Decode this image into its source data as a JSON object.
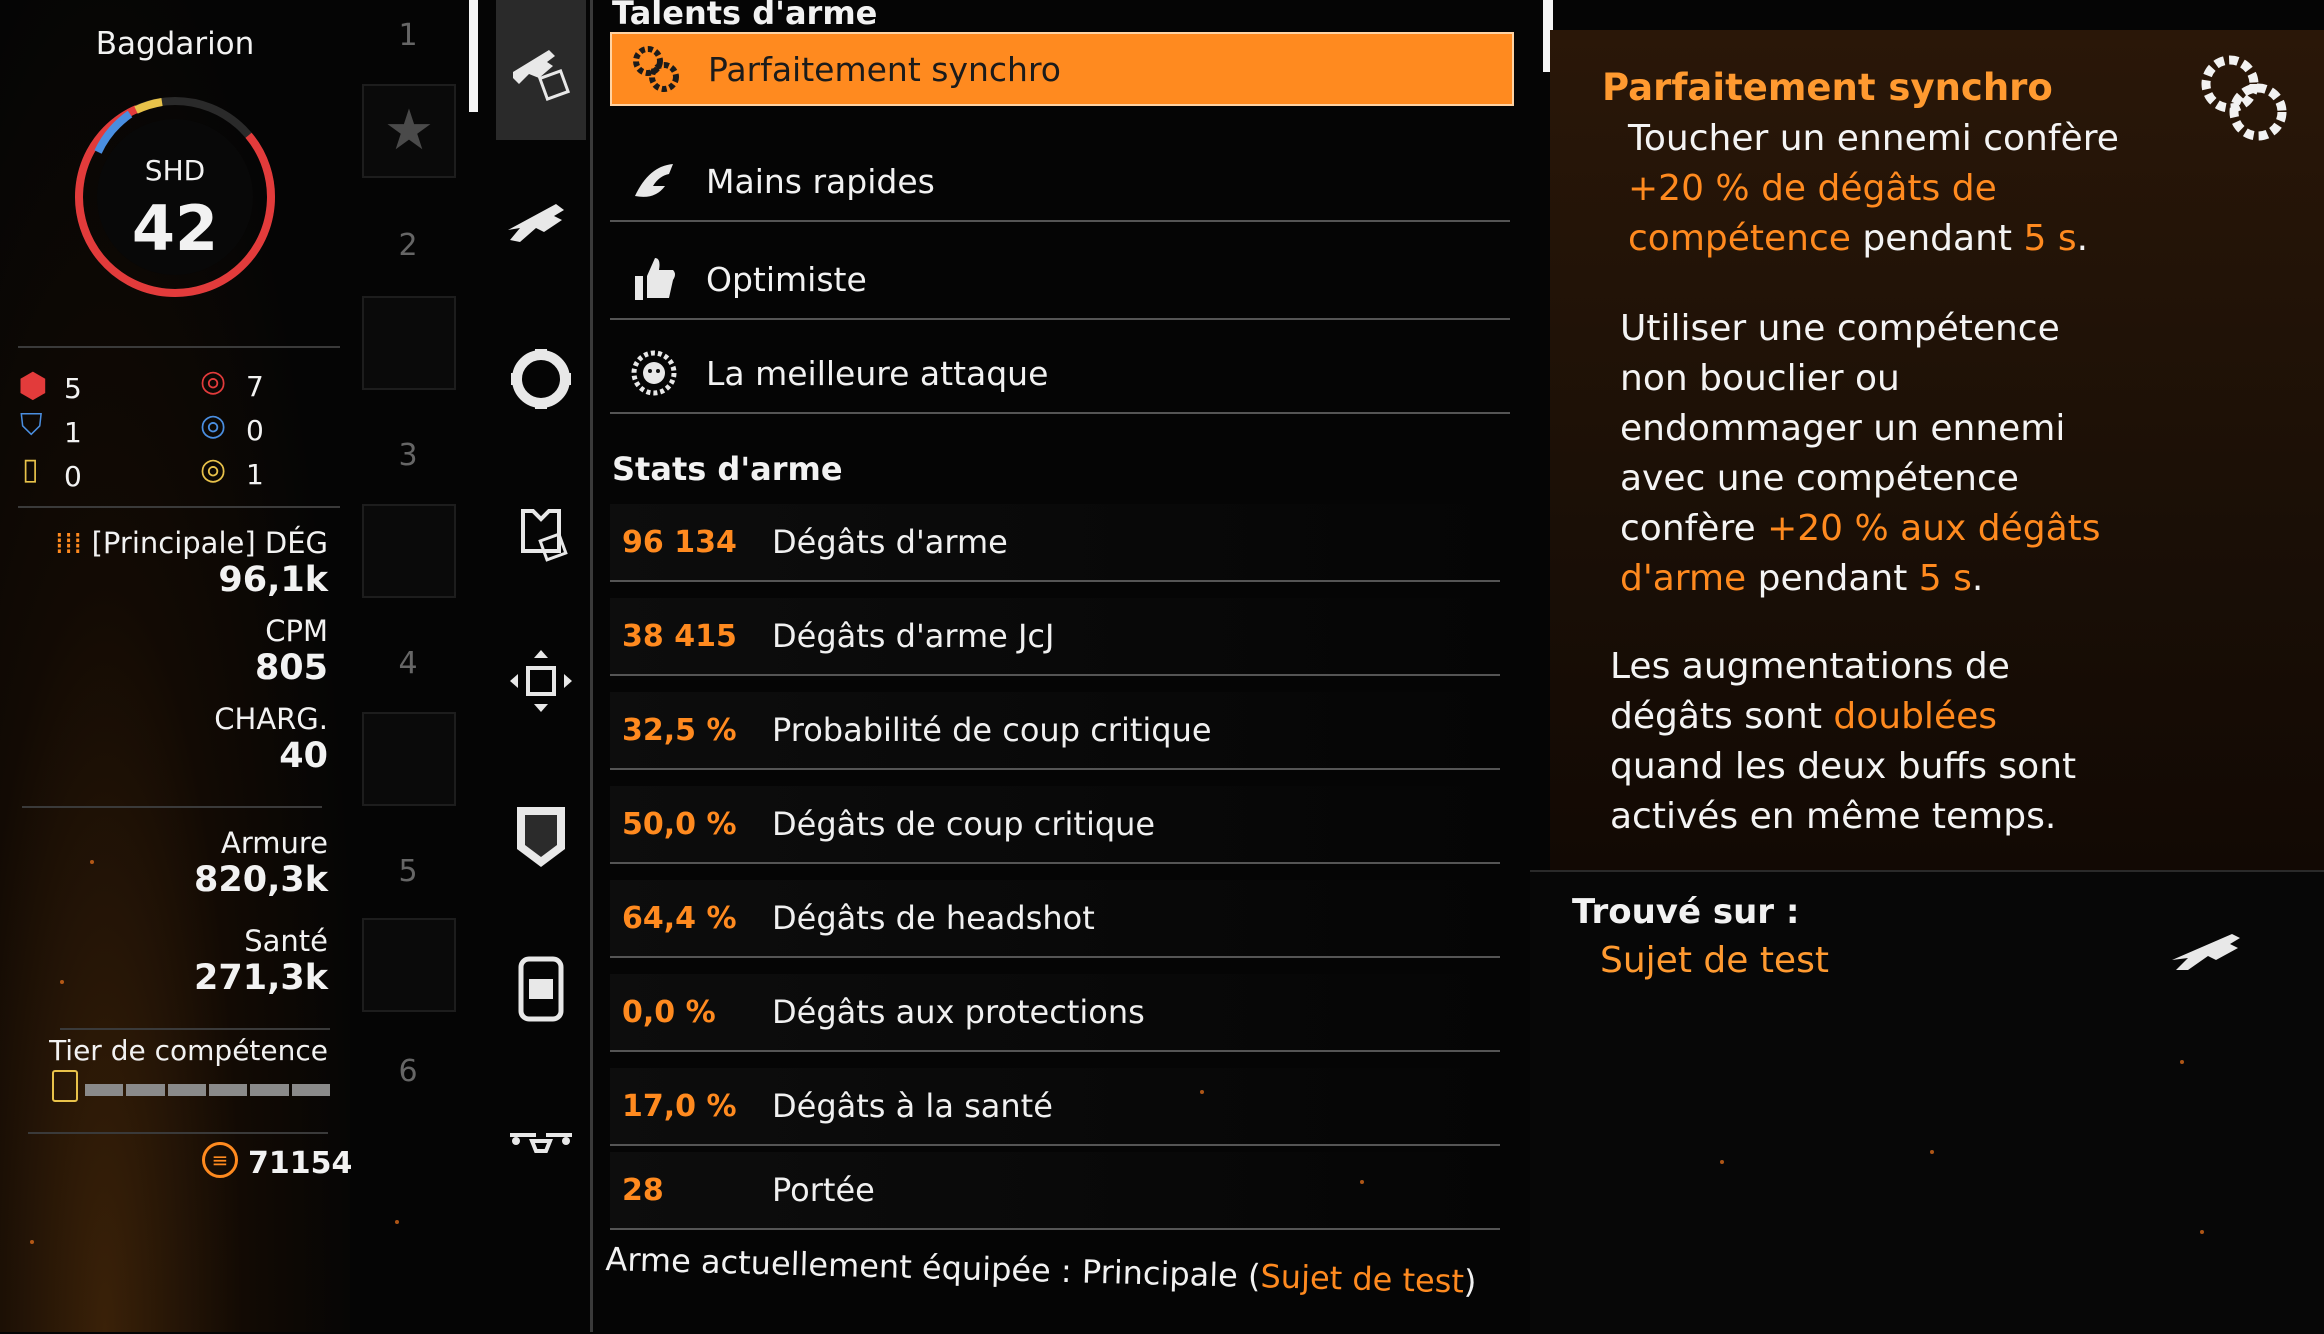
{
  "player": {
    "name": "Bagdarion",
    "rank_label": "SHD",
    "level": "42"
  },
  "core_attributes": {
    "left": [
      {
        "icon": "red-offense-icon",
        "value": "5"
      },
      {
        "icon": "blue-defense-icon",
        "value": "1"
      },
      {
        "icon": "yellow-utility-icon",
        "value": "0"
      }
    ],
    "right": [
      {
        "icon": "red-offense-mod-icon",
        "value": "7"
      },
      {
        "icon": "blue-defense-mod-icon",
        "value": "0"
      },
      {
        "icon": "yellow-utility-mod-icon",
        "value": "1"
      }
    ]
  },
  "weapon_stats": {
    "damage_label": "[Principale] DÉG",
    "damage_value": "96,1k",
    "rpm_label": "CPM",
    "rpm_value": "805",
    "mag_label": "CHARG.",
    "mag_value": "40"
  },
  "armor": {
    "label": "Armure",
    "value": "820,3k"
  },
  "health": {
    "label": "Santé",
    "value": "271,3k"
  },
  "skill_tier": {
    "label": "Tier de compétence",
    "level": 0
  },
  "currency": {
    "value": "71154"
  },
  "slots": [
    "1",
    "2",
    "3",
    "4",
    "5",
    "6"
  ],
  "nav": {
    "items": [
      "weapon-talent-mod",
      "assault-rifle",
      "mask-gear",
      "chest-gear",
      "holster-gear",
      "kneepads-gear",
      "backpack-gear",
      "drone-skill"
    ]
  },
  "talents": {
    "title": "Talents d'arme",
    "items": [
      {
        "icon": "perfectly-synced-icon",
        "label": "Parfaitement synchro",
        "selected": true
      },
      {
        "icon": "fast-hands-icon",
        "label": "Mains rapides",
        "selected": false
      },
      {
        "icon": "thumbs-up-icon",
        "label": "Optimiste",
        "selected": false
      },
      {
        "icon": "lion-head-icon",
        "label": "La meilleure attaque",
        "selected": false
      }
    ]
  },
  "stats": {
    "title": "Stats d'arme",
    "rows": [
      {
        "value": "96 134",
        "label": "Dégâts d'arme"
      },
      {
        "value": "38 415",
        "label": "Dégâts d'arme JcJ"
      },
      {
        "value": "32,5 %",
        "label": "Probabilité de coup critique"
      },
      {
        "value": "50,0 %",
        "label": "Dégâts de coup critique"
      },
      {
        "value": "64,4 %",
        "label": "Dégâts de headshot"
      },
      {
        "value": "0,0 %",
        "label": "Dégâts aux protections"
      },
      {
        "value": "17,0 %",
        "label": "Dégâts à la santé"
      },
      {
        "value": "28",
        "label": "Portée"
      }
    ]
  },
  "equipped": {
    "prefix": "Arme actuellement équipée : Principale (",
    "weapon": "Sujet de test",
    "suffix": ")"
  },
  "detail": {
    "title": "Parfaitement synchro",
    "p1": {
      "a": "Toucher un ennemi confère",
      "b": "+20 % de dégâts de",
      "c": "compétence",
      "d": " pendant ",
      "e": "5 s",
      "f": "."
    },
    "p2": {
      "a": "Utiliser une compétence",
      "b": "non bouclier ou",
      "c": "endommager un ennemi",
      "d": "avec une compétence",
      "e": "confère ",
      "f": "+20 % aux dégâts",
      "g": "d'arme",
      "h": " pendant ",
      "i": "5 s",
      "j": "."
    },
    "p3": {
      "a": "Les augmentations de",
      "b": "dégâts sont ",
      "c": "doublées",
      "d": "quand les deux buffs sont",
      "e": "activés en même temps."
    }
  },
  "found_on": {
    "label": "Trouvé sur :",
    "value": "Sujet de test"
  },
  "colors": {
    "accent": "#ff8a1f",
    "offense": "#e23b3b",
    "defense": "#4a8ee0",
    "utility": "#e8c24a"
  }
}
